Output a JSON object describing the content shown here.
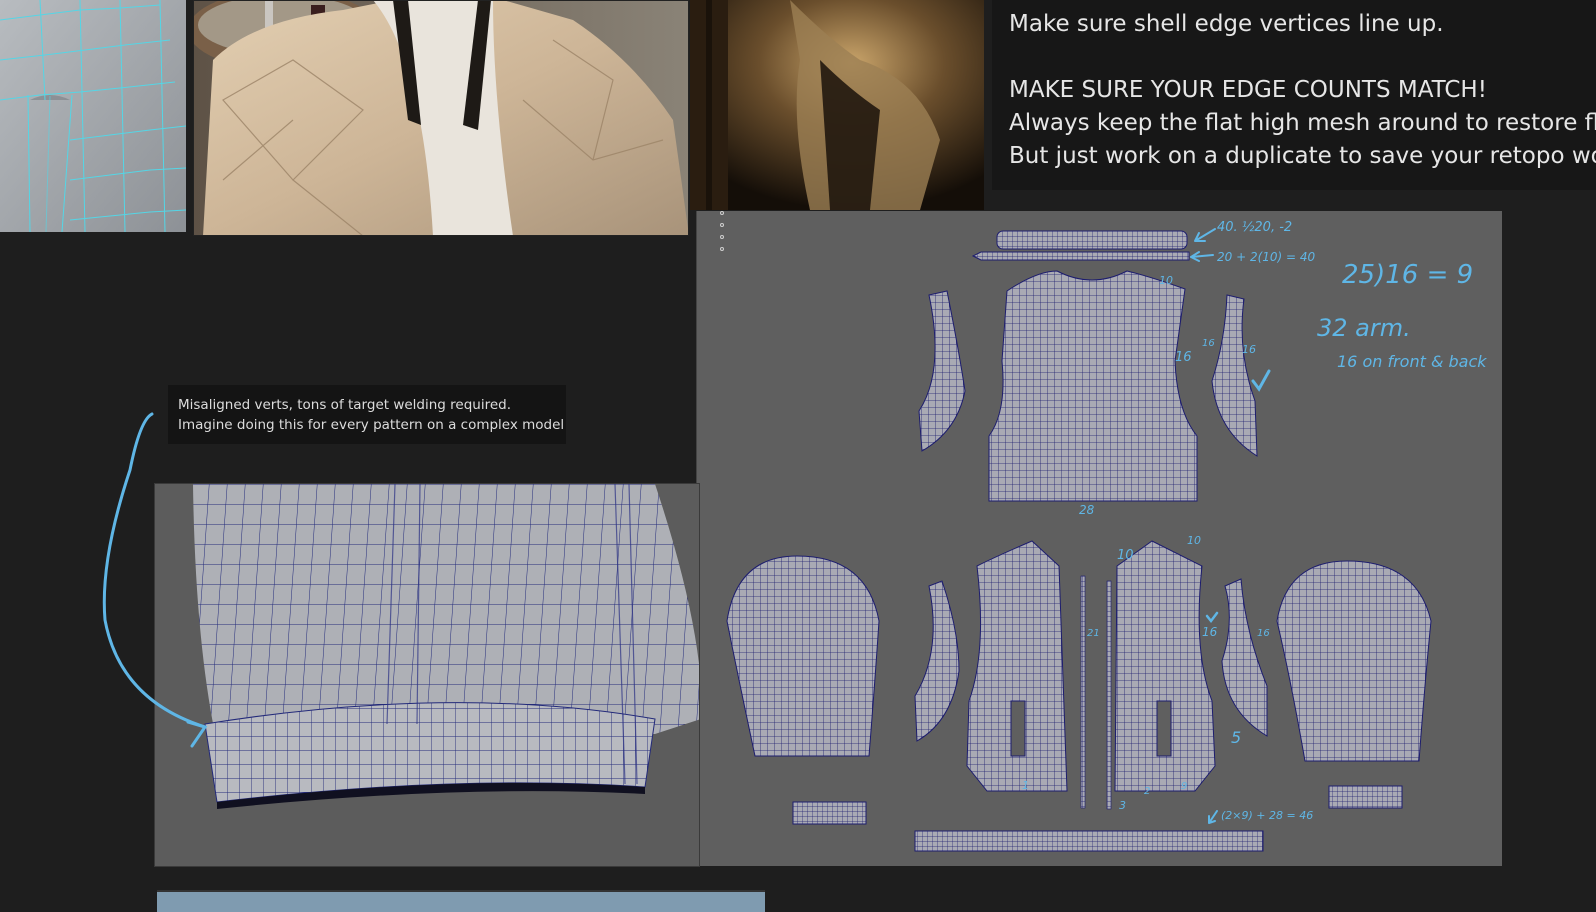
{
  "notes": {
    "line1": "Make sure shell edge vertices line up.",
    "line2": "MAKE SURE YOUR EDGE COUNTS MATCH!",
    "line3": "Always keep the flat high mesh around to restore fla",
    "line4": "But just work on a duplicate to save your retopo wor"
  },
  "callout": {
    "line1": "Misaligned verts, tons of target welding required.",
    "line2": "Imagine doing this for every pattern on a complex model"
  },
  "handwriting": {
    "collar_note": "40. ½20, -2",
    "band_note": "20 + 2(10) = 40",
    "division": "25)16 = 9",
    "arm_count": "32 arm.",
    "arm_split": "16 on front & back",
    "back_width": "28",
    "back_top": "10",
    "back_side": "16",
    "side_left": "16",
    "side_right": "16",
    "front_left_top": "10",
    "front_right_top": "10",
    "front_left_mid": "21",
    "front_right_mid": "16",
    "front_right_side": "16",
    "front_right_low": "5",
    "front_bottom_a": "1",
    "front_bottom_b": "3",
    "front_bottom_c": "2",
    "front_bottom_d": "9",
    "hem_note": "(2×9) + 28 = 46"
  },
  "colors": {
    "annotation": "#5fb6e6",
    "wire": "#1d1d6e",
    "uv_fill": "#a9aab4",
    "sheet": "#5f5f5f"
  }
}
